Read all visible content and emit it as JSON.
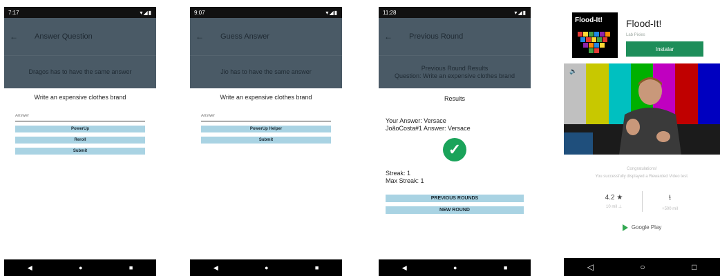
{
  "screens": [
    {
      "time": "7:17",
      "signal": "▾◢▮",
      "title": "Answer Question",
      "banner_lines": [
        "Dragos has to have the same answer"
      ],
      "question": "Write an expensive clothes brand",
      "input_placeholder": "Answer",
      "buttons": [
        "PowerUp",
        "Reroll",
        "Submit"
      ]
    },
    {
      "time": "9:07",
      "signal": "▾◢▮",
      "title": "Guess Answer",
      "banner_lines": [
        "Jio has to have the same answer"
      ],
      "question": "Write an expensive clothes brand",
      "input_placeholder": "Answer",
      "buttons": [
        "PowerUp Helper",
        "Submit"
      ]
    },
    {
      "time": "11:28",
      "signal": "▾◢▮",
      "title": "Previous Round",
      "banner_lines": [
        "Previous Round Results",
        "Question: Write an expensive clothes brand"
      ],
      "results_title": "Results",
      "your_answer": "Your Answer: Versace",
      "other_answer": "JoãoCosta#1 Answer: Versace",
      "streak": "Streak: 1",
      "max_streak": "Max Streak: 1",
      "buttons": [
        "PREVIOUS ROUNDS",
        "NEW ROUND"
      ]
    }
  ],
  "nav": {
    "back": "◀",
    "home": "●",
    "recent": "■"
  },
  "ad": {
    "app_name": "Flood-It!",
    "icon_text": "Flood-It!",
    "developer": "Lab Pixies",
    "install_label": "Instalar",
    "congrats": "Congratulations!",
    "congrats_sub": "You successfully displayed a Rewarded Video test.",
    "rating": "4.2 ★",
    "rating_sub": "10 mil ⊥",
    "downloads_icon": "⭳",
    "downloads_sub": "+500 mil",
    "store_label": "Google Play",
    "nav": {
      "back": "◁",
      "home": "○",
      "recent": "□"
    },
    "colors": {
      "install": "#1e8e5a",
      "check": "#1aa35a"
    }
  }
}
